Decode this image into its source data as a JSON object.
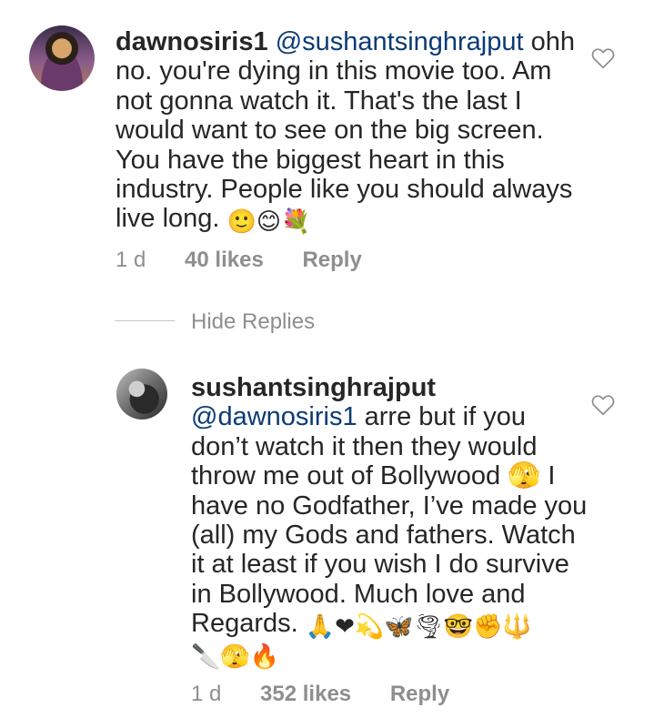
{
  "comments": [
    {
      "username": "dawnosiris1",
      "mention": "@sushantsinghrajput",
      "lines": [
        " ohh",
        "no. you're dying in this movie too. Am",
        "not gonna watch it. That's the last I",
        "would want to see on the big screen.",
        "You have the biggest heart in this",
        "industry. People like you should always",
        "live long. "
      ],
      "emojis": [
        "🙂",
        "😊",
        "💐"
      ],
      "time": "1 d",
      "likes": "40 likes",
      "reply": "Reply"
    },
    {
      "username": "sushantsinghrajput",
      "mention": "@dawnosiris1",
      "lines": [
        " arre but if you",
        "don’t watch it then they would",
        "throw me out of Bollywood 🫣 I",
        "have no Godfather, I’ve made you",
        "(all) my Gods and fathers. Watch",
        "it at least if you wish I do survive",
        "in Bollywood. Much love and",
        "Regards. "
      ],
      "emojis_line1": [
        "🙏",
        "❤",
        "💫",
        "🦋",
        "🌪",
        "🤓",
        "✊",
        "🔱"
      ],
      "emojis_line2": [
        "🔪",
        "🫣",
        "🔥"
      ],
      "time": "1 d",
      "likes": "352 likes",
      "reply": "Reply"
    }
  ],
  "hide_replies": "Hide Replies",
  "icons": {
    "like": "heart-outline-icon"
  },
  "colors": {
    "mention": "#0b3b75",
    "meta": "#8e8e8e",
    "text": "#262626"
  }
}
